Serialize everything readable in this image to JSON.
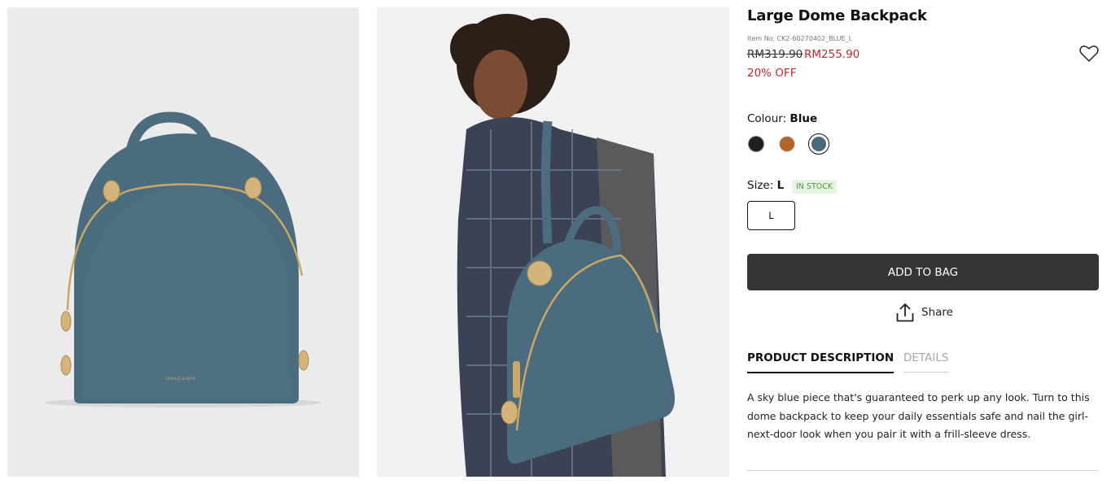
{
  "product": {
    "title": "Large Dome Backpack",
    "item_no": "Item No. CK2-60270402_BLUE_L",
    "original_price": "RM319.90",
    "sale_price": "RM255.90",
    "discount": "20% OFF"
  },
  "colour": {
    "label": "Colour:",
    "selected": "Blue",
    "options": [
      {
        "name": "Black",
        "hex": "#1f1f1f"
      },
      {
        "name": "Cognac",
        "hex": "#b5652b"
      },
      {
        "name": "Blue",
        "hex": "#4a6a7c"
      }
    ]
  },
  "size": {
    "label": "Size:",
    "selected": "L",
    "stock_status": "IN STOCK",
    "options": [
      "L"
    ]
  },
  "actions": {
    "add_to_bag": "ADD TO BAG",
    "share": "Share"
  },
  "tabs": {
    "description": "PRODUCT DESCRIPTION",
    "details": "DETAILS"
  },
  "description": "A sky blue piece that's guaranteed to perk up any look. Turn to this dome backpack to keep your daily essentials safe and nail the girl-next-door look when you pair it with a frill-sleeve dress.",
  "images": {
    "bag_logo": "CHARLES & KEITH"
  },
  "colors": {
    "sale_red": "#c1272d",
    "button_dark": "#353535",
    "stock_green": "#4a9a3d",
    "bag_blue": "#4a6a7c"
  },
  "icons": [
    "heart-icon",
    "share-upload-icon"
  ]
}
